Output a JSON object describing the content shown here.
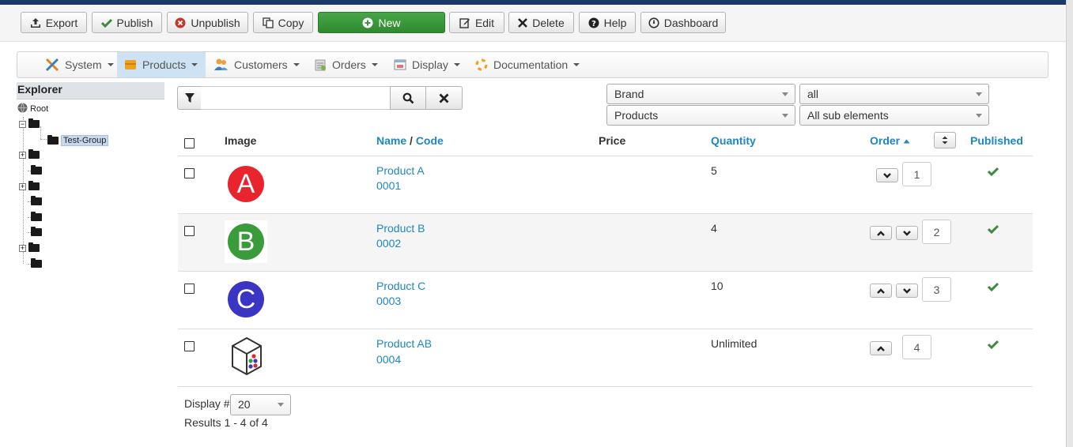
{
  "toolbar": {
    "export": "Export",
    "publish": "Publish",
    "unpublish": "Unpublish",
    "copy": "Copy",
    "new": "New",
    "edit": "Edit",
    "delete": "Delete",
    "help": "Help",
    "dashboard": "Dashboard"
  },
  "menu": {
    "system": "System",
    "products": "Products",
    "customers": "Customers",
    "orders": "Orders",
    "display": "Display",
    "documentation": "Documentation"
  },
  "explorer": {
    "title": "Explorer",
    "root": "Root",
    "selected_group": "Test-Group"
  },
  "filter": {
    "search_value": "",
    "brand": "Brand",
    "brand_value": "all",
    "scope": "Products",
    "scope_value": "All sub elements"
  },
  "table": {
    "headers": {
      "image": "Image",
      "name": "Name",
      "slash": "/",
      "code": "Code",
      "price": "Price",
      "quantity": "Quantity",
      "order": "Order",
      "published": "Published"
    },
    "rows": [
      {
        "name": "Product A",
        "code": "0001",
        "price": "",
        "quantity": "5",
        "order": "1",
        "letter": "A",
        "color": "#e8242c"
      },
      {
        "name": "Product B",
        "code": "0002",
        "price": "",
        "quantity": "4",
        "order": "2",
        "letter": "B",
        "color": "#3a9b3a"
      },
      {
        "name": "Product C",
        "code": "0003",
        "price": "",
        "quantity": "10",
        "order": "3",
        "letter": "C",
        "color": "#3a35c2"
      },
      {
        "name": "Product AB",
        "code": "0004",
        "price": "",
        "quantity": "Unlimited",
        "order": "4",
        "letter": "",
        "color": ""
      }
    ]
  },
  "footer": {
    "display_label": "Display #",
    "display_value": "20",
    "results": "Results 1 - 4 of 4"
  },
  "colors": {
    "link": "#1f86c0",
    "published_check": "#3c8b3c",
    "new_button": "#3a983a",
    "active_menu": "#cde3f3"
  }
}
